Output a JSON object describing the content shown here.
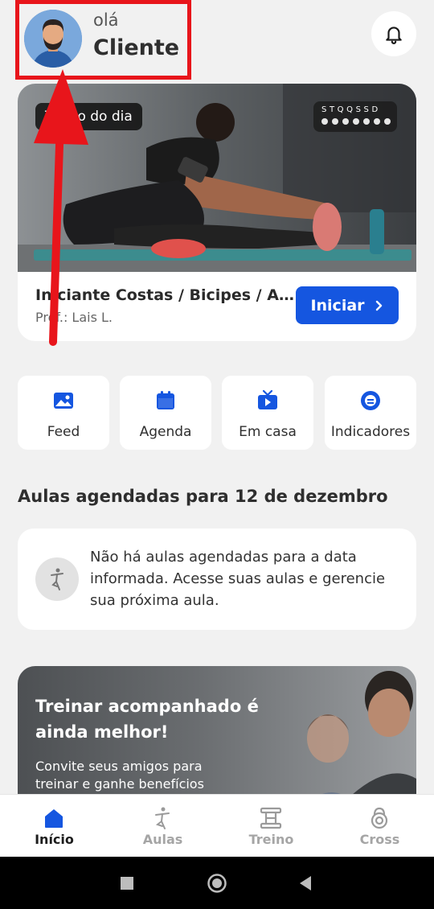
{
  "header": {
    "greeting": "olá",
    "user_name": "Cliente"
  },
  "workout": {
    "badge": "Treino do dia",
    "week_letters": "STQQSSD",
    "title": "Iniciante Costas / Bicipes / An...",
    "professor": "Prof.: Lais L.",
    "start_label": "Iniciar"
  },
  "quick_actions": [
    {
      "label": "Feed",
      "icon": "image-icon"
    },
    {
      "label": "Agenda",
      "icon": "calendar-icon"
    },
    {
      "label": "Em casa",
      "icon": "tv-play-icon"
    },
    {
      "label": "Indicadores",
      "icon": "gauge-icon"
    }
  ],
  "classes": {
    "title": "Aulas agendadas para 12 de dezembro",
    "empty_message": "Não há aulas agendadas para a data informada. Acesse suas aulas e gerencie sua próxima aula."
  },
  "promo": {
    "title": "Treinar acompanhado é ainda melhor!",
    "subtitle": "Convite seus amigos para treinar e ganhe benefícios"
  },
  "nav": [
    {
      "label": "Início",
      "icon": "home-icon",
      "active": true
    },
    {
      "label": "Aulas",
      "icon": "yoga-pose-icon",
      "active": false
    },
    {
      "label": "Treino",
      "icon": "dumbbell-icon",
      "active": false
    },
    {
      "label": "Cross",
      "icon": "kettlebell-icon",
      "active": false
    }
  ],
  "colors": {
    "accent": "#1556e0",
    "annotation": "#e8151b",
    "background": "#f1f1f1"
  }
}
